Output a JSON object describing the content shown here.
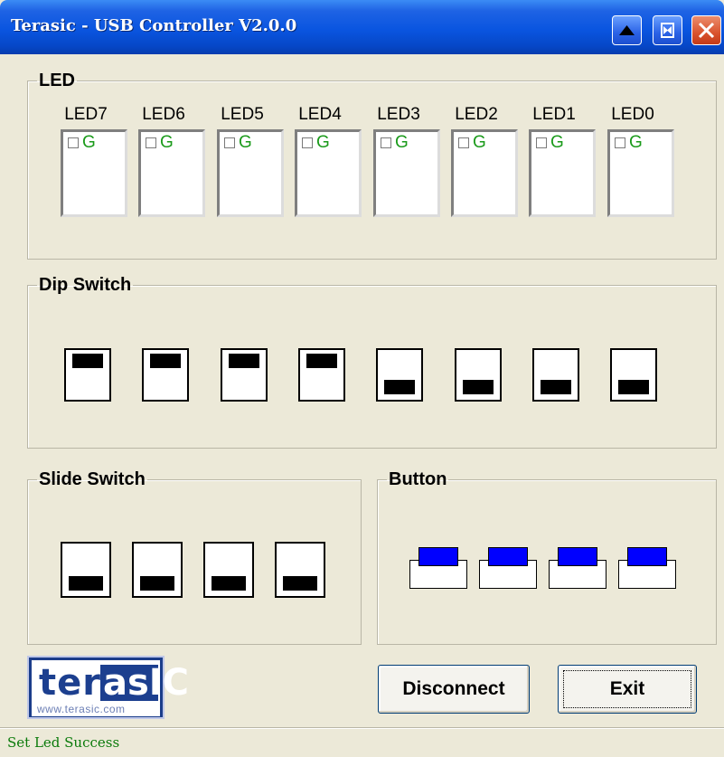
{
  "window": {
    "title": "Terasic - USB Controller V2.0.0"
  },
  "titlebar_buttons": [
    "minimize-up-icon",
    "restore-icon",
    "close-icon"
  ],
  "led_group": {
    "legend": "LED",
    "leds": [
      {
        "label": "LED7",
        "color_letter": "G",
        "checked": false
      },
      {
        "label": "LED6",
        "color_letter": "G",
        "checked": false
      },
      {
        "label": "LED5",
        "color_letter": "G",
        "checked": false
      },
      {
        "label": "LED4",
        "color_letter": "G",
        "checked": false
      },
      {
        "label": "LED3",
        "color_letter": "G",
        "checked": false
      },
      {
        "label": "LED2",
        "color_letter": "G",
        "checked": false
      },
      {
        "label": "LED1",
        "color_letter": "G",
        "checked": false
      },
      {
        "label": "LED0",
        "color_letter": "G",
        "checked": false
      }
    ]
  },
  "dip_switch_group": {
    "legend": "Dip Switch",
    "states": [
      "up",
      "up",
      "up",
      "up",
      "down",
      "down",
      "down",
      "down"
    ]
  },
  "slide_switch_group": {
    "legend": "Slide Switch",
    "states": [
      "down",
      "down",
      "down",
      "down"
    ]
  },
  "button_group": {
    "legend": "Button",
    "count": 4,
    "cap_color": "#0000ff"
  },
  "logo": {
    "part1": "ter",
    "part2": "asIC",
    "url": "www.terasic.com"
  },
  "actions": {
    "disconnect_label": "Disconnect",
    "exit_label": "Exit"
  },
  "status": {
    "text": "Set Led Success",
    "color": "#0a7a0a"
  }
}
